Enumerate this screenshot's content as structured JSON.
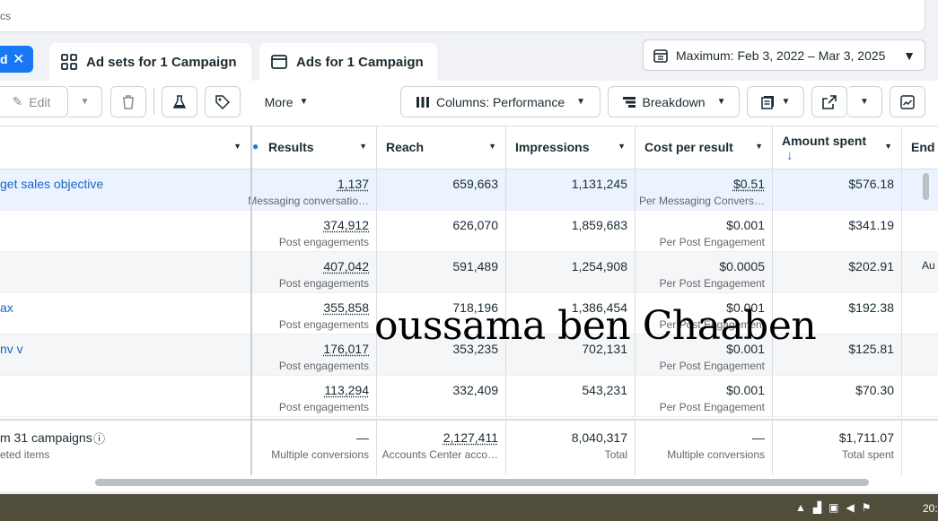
{
  "search": {
    "text": "cs"
  },
  "tabs": {
    "campaign_label": "d",
    "adsets_label": "Ad sets for 1 Campaign",
    "ads_label": "Ads for 1 Campaign"
  },
  "date_range": "Maximum: Feb 3, 2022 – Mar 3, 2025",
  "toolbar": {
    "edit": "Edit",
    "more": "More",
    "columns": "Columns: Performance",
    "breakdown": "Breakdown"
  },
  "columns": {
    "results": "Results",
    "reach": "Reach",
    "impressions": "Impressions",
    "cost_per_result": "Cost per result",
    "amount_spent": "Amount spent",
    "ends": "End"
  },
  "rows": [
    {
      "name": "get sales objective",
      "results": "1,137",
      "results_type": "Messaging conversatio…",
      "reach": "659,663",
      "impressions": "1,131,245",
      "cpr": "$0.51",
      "cpr_type": "Per Messaging Convers…",
      "spent": "$576.18",
      "ends": ""
    },
    {
      "name": "",
      "results": "374,912",
      "results_type": "Post engagements",
      "reach": "626,070",
      "impressions": "1,859,683",
      "cpr": "$0.001",
      "cpr_type": "Per Post Engagement",
      "spent": "$341.19",
      "ends": ""
    },
    {
      "name": "",
      "results": "407,042",
      "results_type": "Post engagements",
      "reach": "591,489",
      "impressions": "1,254,908",
      "cpr": "$0.0005",
      "cpr_type": "Per Post Engagement",
      "spent": "$202.91",
      "ends": "Au"
    },
    {
      "name": "ax",
      "results": "355,858",
      "results_type": "Post engagements",
      "reach": "718,196",
      "impressions": "1,386,454",
      "cpr": "$0.001",
      "cpr_type": "Per Post Engagement",
      "spent": "$192.38",
      "ends": ""
    },
    {
      "name": "nv v",
      "results": "176,017",
      "results_type": "Post engagements",
      "reach": "353,235",
      "impressions": "702,131",
      "cpr": "$0.001",
      "cpr_type": "Per Post Engagement",
      "spent": "$125.81",
      "ends": ""
    },
    {
      "name": "",
      "results": "113,294",
      "results_type": "Post engagements",
      "reach": "332,409",
      "impressions": "543,231",
      "cpr": "$0.001",
      "cpr_type": "Per Post Engagement",
      "spent": "$70.30",
      "ends": ""
    }
  ],
  "summary": {
    "name": "m 31 campaigns",
    "name_sub": "eted items",
    "results": "—",
    "results_sub": "Multiple conversions",
    "reach": "2,127,411",
    "reach_sub": "Accounts Center acco…",
    "impressions": "8,040,317",
    "impressions_sub": "Total",
    "cpr": "—",
    "cpr_sub": "Multiple conversions",
    "spent": "$1,711.07",
    "spent_sub": "Total spent"
  },
  "watermark": "oussama ben Chaaben",
  "taskbar": {
    "clock": "20:"
  },
  "icons": {
    "close": "close-icon",
    "adsets": "grid-icon",
    "ads": "ad-icon",
    "calendar": "calendar-icon",
    "edit": "pencil-icon",
    "delete": "trash-icon",
    "test": "flask-icon",
    "tag": "tag-icon",
    "columns": "columns-icon",
    "breakdown": "breakdown-icon",
    "reports": "reports-icon",
    "export": "export-icon",
    "chart": "chart-icon"
  },
  "colors": {
    "accent": "#1877f2",
    "link": "#1a66c9",
    "selected_row": "#eaf3ff"
  }
}
